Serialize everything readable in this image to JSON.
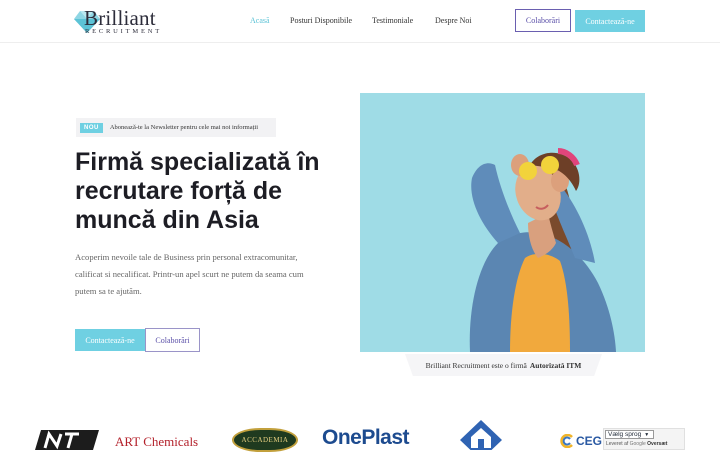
{
  "header": {
    "logo_name": "Brilliant",
    "logo_sub": "RECRUITMENT",
    "nav": [
      "Acasă",
      "Posturi Disponibile",
      "Testimoniale",
      "Despre Noi"
    ],
    "collab_label": "Colaborări",
    "contact_label": "Contactează-ne"
  },
  "hero": {
    "badge": "NOU",
    "newsletter": "Abonează-te la Newsletter pentru cele mai noi informații",
    "title": "Firmă specializată în recrutare forță de muncă din Asia",
    "description": "Acoperim nevoile tale de Business prin personal extracomunitar, calificat si necalificat. Printr-un apel scurt ne putem da seama cum putem sa te ajutăm.",
    "contact_label": "Contactează-ne",
    "collab_label": "Colaborări"
  },
  "itm_note": {
    "text": "Brilliant Recruitment este o firmă",
    "bold": "Autorizată ITM"
  },
  "partners": [
    "ART Chemicals",
    "ACCADEMIA",
    "OnePlast",
    "CEG"
  ],
  "language_widget": {
    "select": "Vælg sprog",
    "powered_by": "Leveret af",
    "google": "Google",
    "service": "Oversæt"
  },
  "colors": {
    "accent": "#6fd0e2",
    "outline": "#6a5fb0",
    "hero_bg": "#9fdce6"
  }
}
